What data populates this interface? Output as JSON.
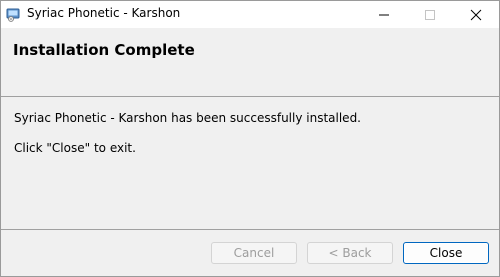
{
  "window": {
    "title": "Syriac Phonetic - Karshon",
    "icon": "installer-app-icon",
    "controls": {
      "minimize": "minimize-icon",
      "maximize": "maximize-icon",
      "close": "close-icon"
    }
  },
  "header": {
    "title": "Installation Complete"
  },
  "body": {
    "message": "Syriac Phonetic - Karshon has been successfully installed.",
    "instruction": "Click \"Close\" to exit."
  },
  "buttons": {
    "cancel": "Cancel",
    "back": "< Back",
    "close": "Close"
  },
  "colors": {
    "accent": "#0067c0",
    "panel": "#f0f0f0",
    "disabled_text": "#9d9d9d"
  }
}
